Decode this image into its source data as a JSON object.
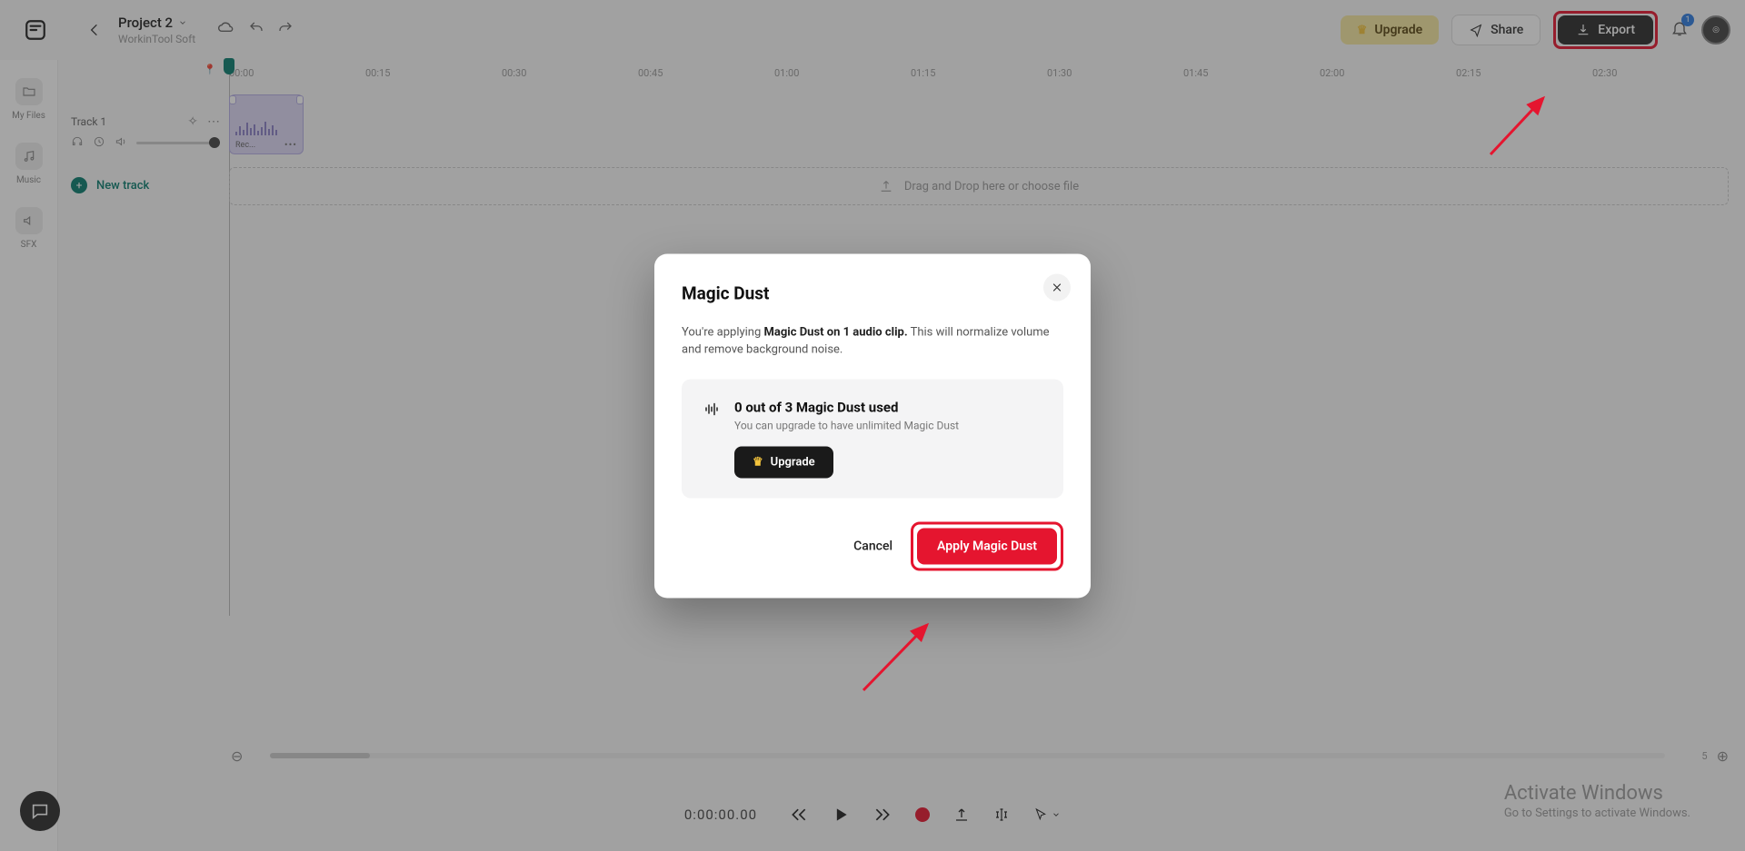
{
  "header": {
    "project_title": "Project 2",
    "project_subtitle": "WorkinTool Soft",
    "upgrade_label": "Upgrade",
    "share_label": "Share",
    "export_label": "Export",
    "notif_count": "1"
  },
  "sidebar": {
    "items": [
      {
        "label": "My Files"
      },
      {
        "label": "Music"
      },
      {
        "label": "SFX"
      }
    ]
  },
  "tracks": {
    "track1_name": "Track 1",
    "newtrack_label": "New track",
    "clip_label": "Rec..."
  },
  "timeline": {
    "ticks": [
      "00:00",
      "00:15",
      "00:30",
      "00:45",
      "01:00",
      "01:15",
      "01:30",
      "01:45",
      "02:00",
      "02:15",
      "02:30"
    ],
    "dropzone_text": "Drag and Drop here or choose file"
  },
  "transport": {
    "timecode": "0:00:00.00"
  },
  "zoom": {
    "percent": "5"
  },
  "watermark": {
    "title": "Activate Windows",
    "sub": "Go to Settings to activate Windows."
  },
  "modal": {
    "title": "Magic Dust",
    "desc_prefix": "You're applying ",
    "desc_bold": "Magic Dust on 1 audio clip.",
    "desc_suffix": " This will normalize volume and remove background noise.",
    "usage_title": "0 out of 3 Magic Dust used",
    "usage_sub": "You can upgrade to have unlimited Magic Dust",
    "upgrade_label": "Upgrade",
    "cancel_label": "Cancel",
    "apply_label": "Apply Magic Dust"
  }
}
